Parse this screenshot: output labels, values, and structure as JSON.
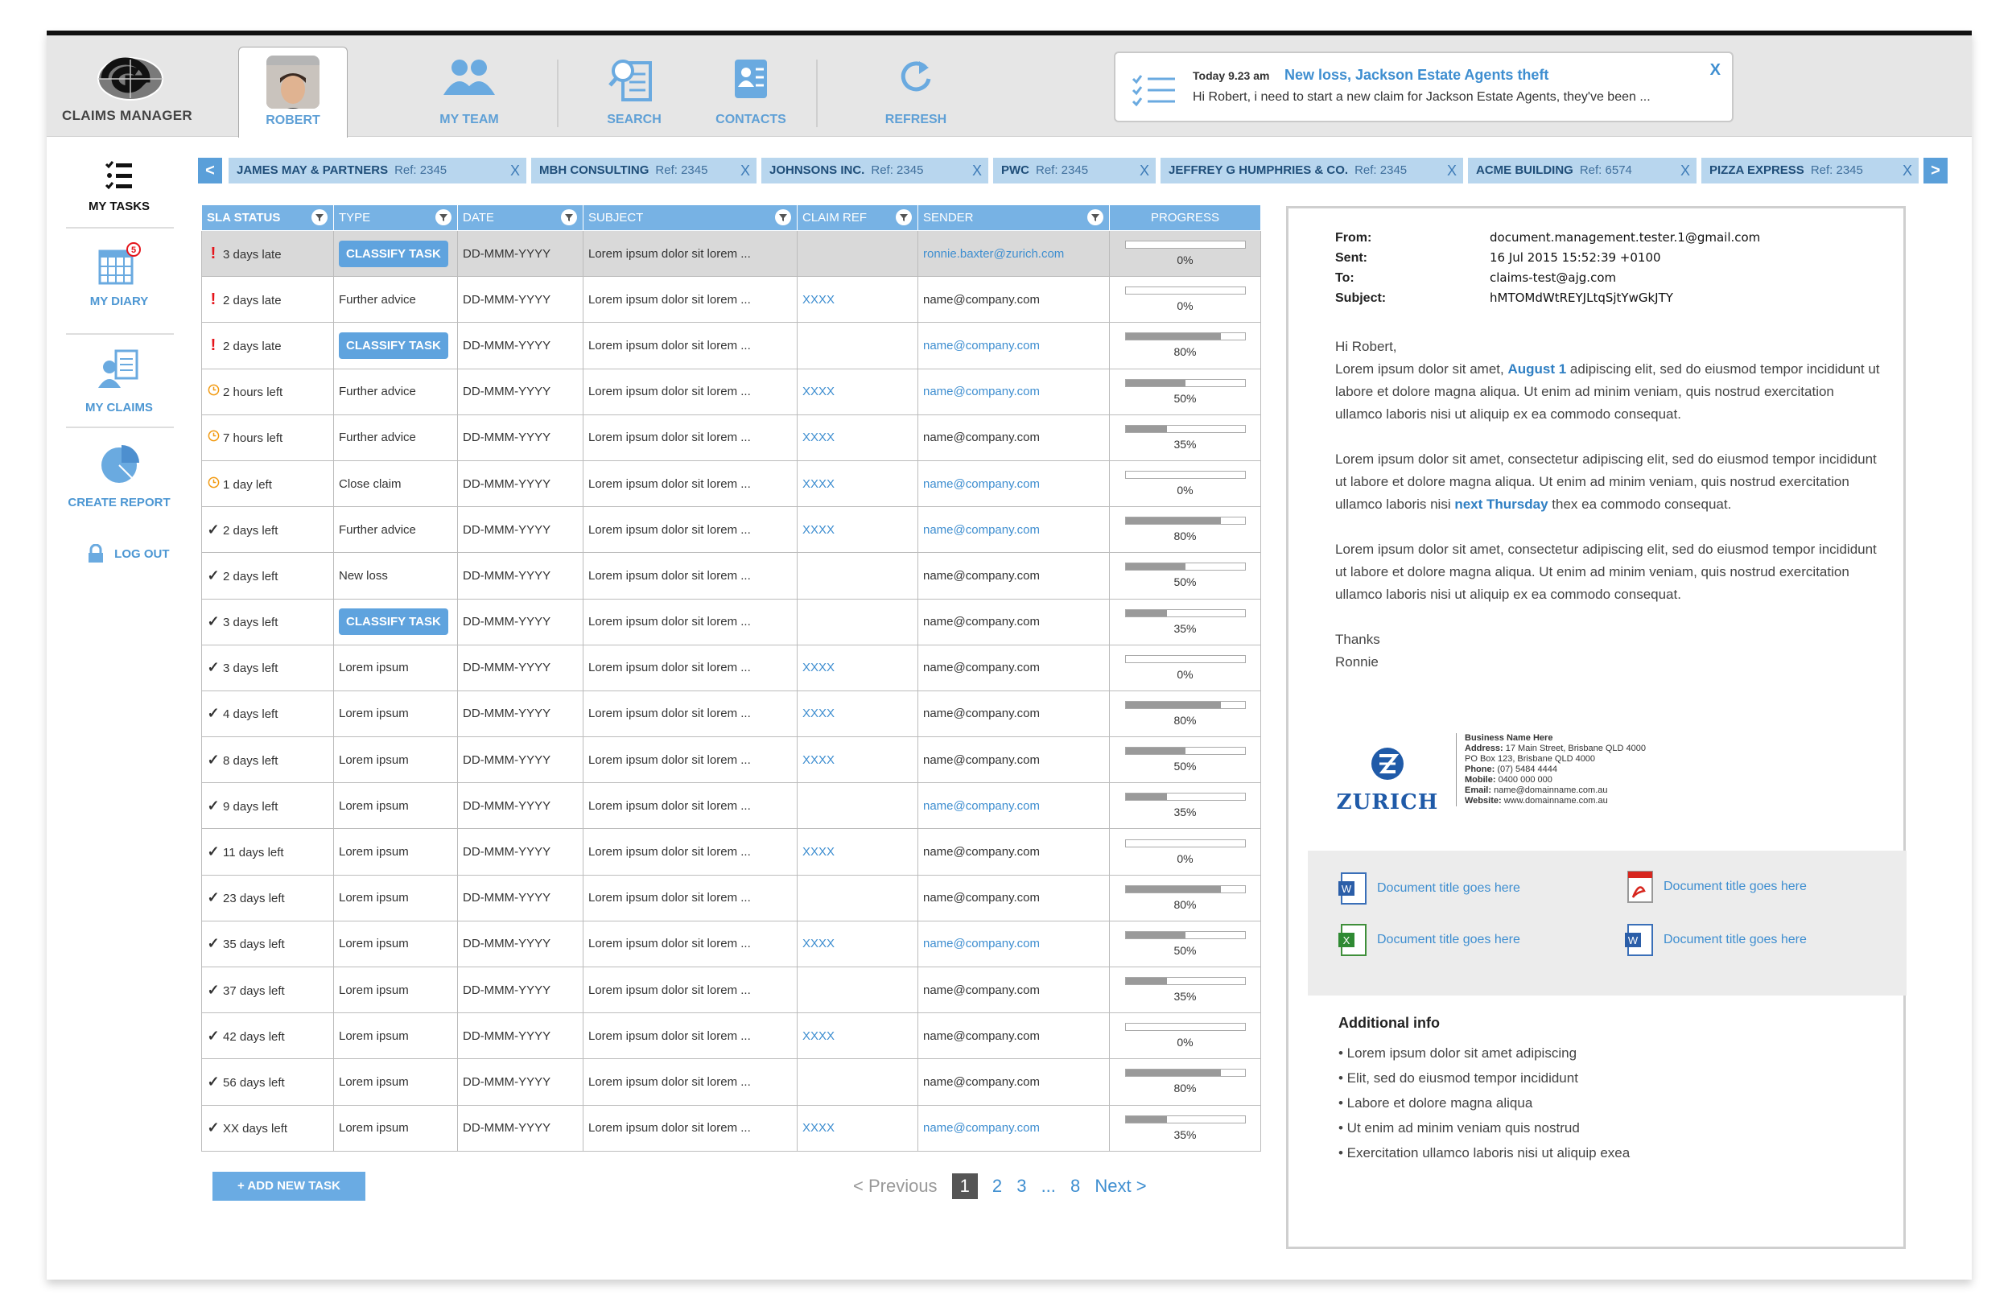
{
  "app": {
    "title": "CLAIMS MANAGER"
  },
  "nav": {
    "user": "ROBERT",
    "team": "MY TEAM",
    "search": "SEARCH",
    "contacts": "CONTACTS",
    "refresh": "REFRESH"
  },
  "notification": {
    "time": "Today 9.23 am",
    "title": "New loss, Jackson Estate Agents theft",
    "body": "Hi Robert, i need to start a new claim for Jackson Estate Agents, they've been ...",
    "close": "X"
  },
  "sidebar": {
    "tasks": "MY TASKS",
    "diary": "MY DIARY",
    "diary_badge": "5",
    "claims": "MY CLAIMS",
    "report": "CREATE REPORT",
    "logout": "LOG OUT"
  },
  "client_strip": {
    "prev": "<",
    "next": ">",
    "clients": [
      {
        "name": "JAMES MAY & PARTNERS",
        "ref": "Ref: 2345",
        "close": "X"
      },
      {
        "name": "MBH CONSULTING",
        "ref": "Ref: 2345",
        "close": "X"
      },
      {
        "name": "JOHNSONS INC.",
        "ref": "Ref: 2345",
        "close": "X"
      },
      {
        "name": "PWC",
        "ref": "Ref: 2345",
        "close": "X"
      },
      {
        "name": "JEFFREY G HUMPHRIES & CO.",
        "ref": "Ref: 2345",
        "close": "X"
      },
      {
        "name": "ACME BUILDING",
        "ref": "Ref: 6574",
        "close": "X"
      },
      {
        "name": "PIZZA EXPRESS",
        "ref": "Ref: 2345",
        "close": "X"
      }
    ]
  },
  "table": {
    "headers": [
      "SLA STATUS",
      "TYPE",
      "DATE",
      "SUBJECT",
      "CLAIM REF",
      "SENDER",
      "PROGRESS"
    ],
    "rows": [
      {
        "sla": "3 days late",
        "state": "late",
        "type": "CLASSIFY TASK",
        "classify": true,
        "date": "DD-MMM-YYYY",
        "subject": "Lorem ipsum dolor sit lorem ...",
        "ref": "",
        "sender": "ronnie.baxter@zurich.com",
        "sender_link": true,
        "progress": 0,
        "progress_label": "0%"
      },
      {
        "sla": "2 days late",
        "state": "late",
        "type": "Further advice",
        "classify": false,
        "date": "DD-MMM-YYYY",
        "subject": "Lorem ipsum dolor sit lorem ...",
        "ref": "XXXX",
        "sender": "name@company.com",
        "sender_link": false,
        "progress": 0,
        "progress_label": "0%"
      },
      {
        "sla": "2 days late",
        "state": "late",
        "type": "CLASSIFY TASK",
        "classify": true,
        "date": "DD-MMM-YYYY",
        "subject": "Lorem ipsum dolor sit lorem ...",
        "ref": "",
        "sender": "name@company.com",
        "sender_link": true,
        "progress": 80,
        "progress_label": "80%"
      },
      {
        "sla": "2 hours left",
        "state": "soon",
        "type": "Further advice",
        "classify": false,
        "date": "DD-MMM-YYYY",
        "subject": "Lorem ipsum dolor sit lorem ...",
        "ref": "XXXX",
        "sender": "name@company.com",
        "sender_link": true,
        "progress": 50,
        "progress_label": "50%"
      },
      {
        "sla": "7 hours left",
        "state": "soon",
        "type": "Further advice",
        "classify": false,
        "date": "DD-MMM-YYYY",
        "subject": "Lorem ipsum dolor sit lorem ...",
        "ref": "XXXX",
        "sender": "name@company.com",
        "sender_link": false,
        "progress": 35,
        "progress_label": "35%"
      },
      {
        "sla": "1 day left",
        "state": "soon",
        "type": "Close claim",
        "classify": false,
        "date": "DD-MMM-YYYY",
        "subject": "Lorem ipsum dolor sit lorem ...",
        "ref": "XXXX",
        "sender": "name@company.com",
        "sender_link": true,
        "progress": 0,
        "progress_label": "0%"
      },
      {
        "sla": "2 days left",
        "state": "ok",
        "type": "Further advice",
        "classify": false,
        "date": "DD-MMM-YYYY",
        "subject": "Lorem ipsum dolor sit lorem ...",
        "ref": "XXXX",
        "sender": "name@company.com",
        "sender_link": true,
        "progress": 80,
        "progress_label": "80%"
      },
      {
        "sla": "2 days left",
        "state": "ok",
        "type": "New loss",
        "classify": false,
        "date": "DD-MMM-YYYY",
        "subject": "Lorem ipsum dolor sit lorem ...",
        "ref": "",
        "sender": "name@company.com",
        "sender_link": false,
        "progress": 50,
        "progress_label": "50%"
      },
      {
        "sla": "3 days left",
        "state": "ok",
        "type": "CLASSIFY TASK",
        "classify": true,
        "date": "DD-MMM-YYYY",
        "subject": "Lorem ipsum dolor sit lorem ...",
        "ref": "",
        "sender": "name@company.com",
        "sender_link": false,
        "progress": 35,
        "progress_label": "35%"
      },
      {
        "sla": "3 days left",
        "state": "ok",
        "type": "Lorem ipsum",
        "classify": false,
        "date": "DD-MMM-YYYY",
        "subject": "Lorem ipsum dolor sit lorem ...",
        "ref": "XXXX",
        "sender": "name@company.com",
        "sender_link": false,
        "progress": 0,
        "progress_label": "0%"
      },
      {
        "sla": "4 days left",
        "state": "ok",
        "type": "Lorem ipsum",
        "classify": false,
        "date": "DD-MMM-YYYY",
        "subject": "Lorem ipsum dolor sit lorem ...",
        "ref": "XXXX",
        "sender": "name@company.com",
        "sender_link": false,
        "progress": 80,
        "progress_label": "80%"
      },
      {
        "sla": "8 days left",
        "state": "ok",
        "type": "Lorem ipsum",
        "classify": false,
        "date": "DD-MMM-YYYY",
        "subject": "Lorem ipsum dolor sit lorem ...",
        "ref": "XXXX",
        "sender": "name@company.com",
        "sender_link": false,
        "progress": 50,
        "progress_label": "50%"
      },
      {
        "sla": "9 days left",
        "state": "ok",
        "type": "Lorem ipsum",
        "classify": false,
        "date": "DD-MMM-YYYY",
        "subject": "Lorem ipsum dolor sit lorem ...",
        "ref": "",
        "sender": "name@company.com",
        "sender_link": true,
        "progress": 35,
        "progress_label": "35%"
      },
      {
        "sla": "11 days left",
        "state": "ok",
        "type": "Lorem ipsum",
        "classify": false,
        "date": "DD-MMM-YYYY",
        "subject": "Lorem ipsum dolor sit lorem ...",
        "ref": "XXXX",
        "sender": "name@company.com",
        "sender_link": false,
        "progress": 0,
        "progress_label": "0%"
      },
      {
        "sla": "23 days left",
        "state": "ok",
        "type": "Lorem ipsum",
        "classify": false,
        "date": "DD-MMM-YYYY",
        "subject": "Lorem ipsum dolor sit lorem ...",
        "ref": "",
        "sender": "name@company.com",
        "sender_link": false,
        "progress": 80,
        "progress_label": "80%"
      },
      {
        "sla": "35 days left",
        "state": "ok",
        "type": "Lorem ipsum",
        "classify": false,
        "date": "DD-MMM-YYYY",
        "subject": "Lorem ipsum dolor sit lorem ...",
        "ref": "XXXX",
        "sender": "name@company.com",
        "sender_link": true,
        "progress": 50,
        "progress_label": "50%"
      },
      {
        "sla": "37 days left",
        "state": "ok",
        "type": "Lorem ipsum",
        "classify": false,
        "date": "DD-MMM-YYYY",
        "subject": "Lorem ipsum dolor sit lorem ...",
        "ref": "",
        "sender": "name@company.com",
        "sender_link": false,
        "progress": 35,
        "progress_label": "35%"
      },
      {
        "sla": "42 days left",
        "state": "ok",
        "type": "Lorem ipsum",
        "classify": false,
        "date": "DD-MMM-YYYY",
        "subject": "Lorem ipsum dolor sit lorem ...",
        "ref": "XXXX",
        "sender": "name@company.com",
        "sender_link": false,
        "progress": 0,
        "progress_label": "0%"
      },
      {
        "sla": "56 days left",
        "state": "ok",
        "type": "Lorem ipsum",
        "classify": false,
        "date": "DD-MMM-YYYY",
        "subject": "Lorem ipsum dolor sit lorem ...",
        "ref": "",
        "sender": "name@company.com",
        "sender_link": false,
        "progress": 80,
        "progress_label": "80%"
      },
      {
        "sla": "XX days left",
        "state": "ok",
        "type": "Lorem ipsum",
        "classify": false,
        "date": "DD-MMM-YYYY",
        "subject": "Lorem ipsum dolor sit lorem ...",
        "ref": "XXXX",
        "sender": "name@company.com",
        "sender_link": true,
        "progress": 35,
        "progress_label": "35%"
      }
    ]
  },
  "actions": {
    "add_task": "+ ADD NEW TASK"
  },
  "pager": {
    "prev": "< Previous",
    "current": "1",
    "p2": "2",
    "p3": "3",
    "ellipsis": "...",
    "last": "8",
    "next": "Next >"
  },
  "email": {
    "from_label": "From:",
    "from": "document.management.tester.1@gmail.com",
    "sent_label": "Sent:",
    "sent": "16 Jul 2015 15:52:39 +0100",
    "to_label": "To:",
    "to": "claims-test@ajg.com",
    "subject_label": "Subject:",
    "subject": "hMTOMdWtREYJLtqSjtYwGkJTY",
    "greeting": "Hi Robert,",
    "p1_a": "Lorem ipsum dolor sit amet, ",
    "p1_hl": "August 1",
    "p1_b": " adipiscing elit, sed do eiusmod tempor incididunt ut labore et dolore magna aliqua. Ut enim ad minim veniam, quis nostrud exercitation ullamco laboris nisi ut aliquip ex ea commodo consequat.",
    "p2_a": "Lorem ipsum dolor sit amet, consectetur adipiscing elit, sed do eiusmod tempor incididunt ut labore et dolore magna aliqua. Ut enim ad minim veniam, quis nostrud exercitation ullamco laboris nisi ",
    "p2_hl": "next Thursday",
    "p2_b": " thex ea commodo consequat.",
    "p3": "Lorem ipsum dolor sit amet, consectetur adipiscing elit, sed do eiusmod tempor incididunt ut labore et dolore magna aliqua. Ut enim ad minim veniam, quis nostrud exercitation ullamco laboris nisi ut aliquip ex ea commodo consequat.",
    "thanks": "Thanks",
    "signoff": "Ronnie",
    "sig_logo": "ZURICH",
    "sig_business": "Business Name Here",
    "sig_address_label": "Address:",
    "sig_address": "17 Main Street, Brisbane QLD 4000",
    "sig_po": "PO Box 123, Brisbane QLD 4000",
    "sig_phone_label": "Phone:",
    "sig_phone": "(07) 5484 4444",
    "sig_mobile_label": "Mobile:",
    "sig_mobile": "0400 000 000",
    "sig_email_label": "Email:",
    "sig_email": "name@domainname.com.au",
    "sig_web_label": "Website:",
    "sig_web": "www.domainname.com.au",
    "attachments": [
      "Document title goes here",
      "Document title goes here",
      "Document title goes here",
      "Document title goes here"
    ],
    "additional_title": "Additional info",
    "additional": [
      "• Lorem ipsum dolor sit amet adipiscing",
      "• Elit, sed do eiusmod tempor incididunt",
      "• Labore et dolore magna aliqua",
      "• Ut enim ad minim veniam quis nostrud",
      "• Exercitation ullamco laboris nisi ut aliquip exea"
    ]
  },
  "colors": {
    "accent": "#5fa3de",
    "header_bg": "#e6e6e6",
    "late": "#e5141b",
    "soon": "#f29b14",
    "ok": "#1f9b27"
  }
}
